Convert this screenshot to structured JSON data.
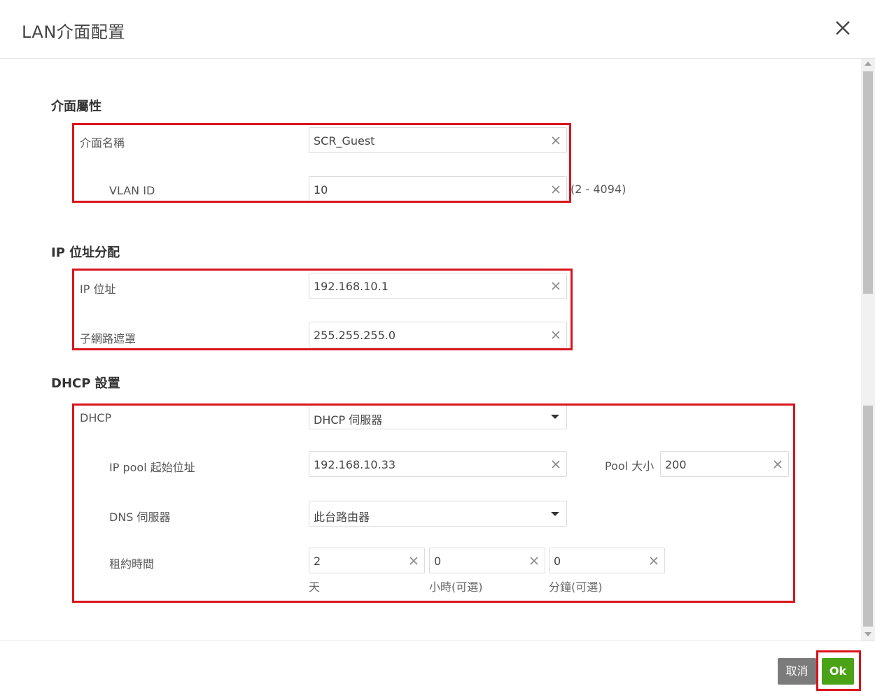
{
  "dialog": {
    "title": "LAN介面配置"
  },
  "sections": {
    "interface": {
      "title": "介面屬性",
      "name_label": "介面名稱",
      "name_value": "SCR_Guest",
      "vlan_label": "VLAN ID",
      "vlan_value": "10",
      "vlan_hint": "(2 - 4094)"
    },
    "ip": {
      "title": "IP 位址分配",
      "ip_label": "IP 位址",
      "ip_value": "192.168.10.1",
      "mask_label": "子網路遮罩",
      "mask_value": "255.255.255.0"
    },
    "dhcp": {
      "title": "DHCP 設置",
      "dhcp_label": "DHCP",
      "dhcp_value": "DHCP 伺服器",
      "pool_start_label": "IP pool 起始位址",
      "pool_start_value": "192.168.10.33",
      "pool_size_label": "Pool 大小",
      "pool_size_value": "200",
      "dns_label": "DNS 伺服器",
      "dns_value": "此台路由器",
      "lease_label": "租約時間",
      "lease_days_value": "2",
      "lease_days_unit": "天",
      "lease_hours_value": "0",
      "lease_hours_unit": "小時(可選)",
      "lease_minutes_value": "0",
      "lease_minutes_unit": "分鐘(可選)"
    }
  },
  "footer": {
    "cancel_label": "取消",
    "ok_label": "Ok"
  },
  "colors": {
    "highlight": "#d9141b",
    "ok_button": "#4aa317",
    "cancel_button": "#7b7b7b"
  },
  "icons": {
    "close": "close-icon",
    "clear": "clear-icon",
    "dropdown": "chevron-down-icon"
  }
}
